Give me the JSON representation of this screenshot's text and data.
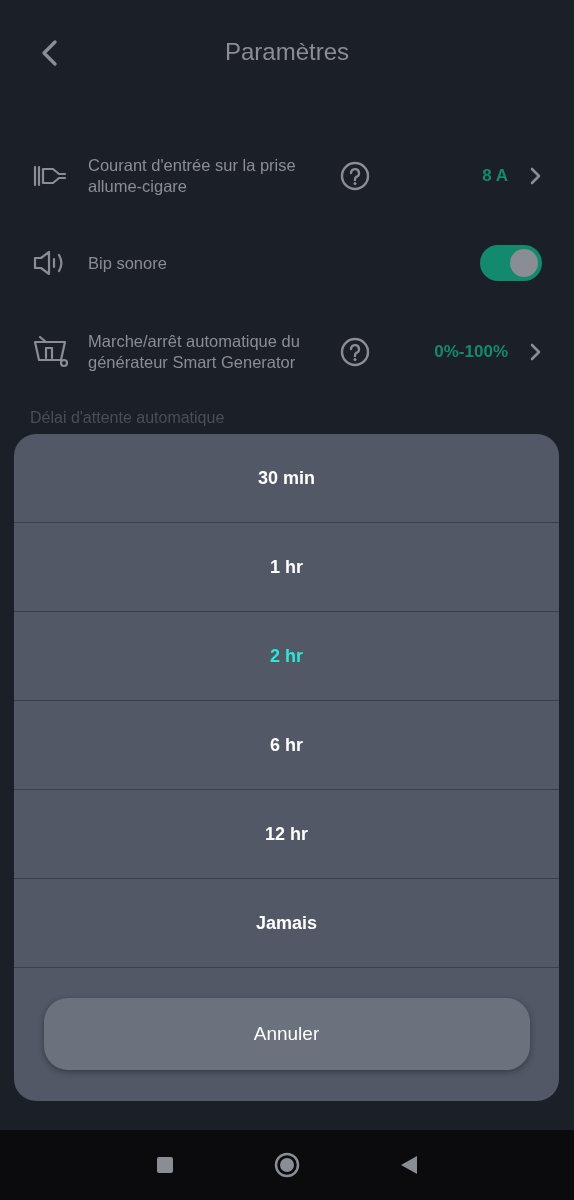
{
  "header": {
    "title": "Paramètres"
  },
  "settings": [
    {
      "kind": "value",
      "label": "Courant d'entrée sur la prise allume-cigare",
      "help": true,
      "value": "8 A"
    },
    {
      "kind": "toggle",
      "label": "Bip sonore",
      "on": true
    },
    {
      "kind": "value",
      "label": "Marche/arrêt automatique du générateur Smart Generator",
      "help": true,
      "value": "0%-100%"
    }
  ],
  "section_label": "Délai d'attente automatique",
  "sheet": {
    "options": [
      {
        "label": "30 min",
        "selected": false
      },
      {
        "label": "1 hr",
        "selected": false
      },
      {
        "label": "2 hr",
        "selected": true
      },
      {
        "label": "6 hr",
        "selected": false
      },
      {
        "label": "12 hr",
        "selected": false
      },
      {
        "label": "Jamais",
        "selected": false
      }
    ],
    "cancel": "Annuler"
  }
}
